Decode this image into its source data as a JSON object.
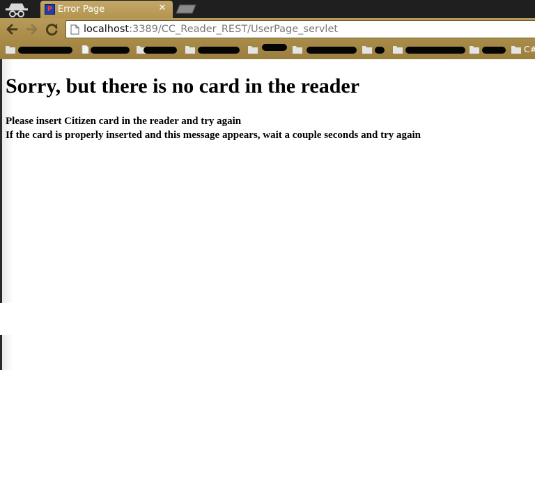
{
  "tab": {
    "title": "Error Page",
    "favicon_glyph": "P",
    "close_icon": "close-icon"
  },
  "address_bar": {
    "host": "localhost",
    "path": ":3389/CC_Reader_REST/UserPage_servlet"
  },
  "bookmarks": [
    {
      "label": "",
      "icon": "folder-icon",
      "redacted": true
    },
    {
      "label": "",
      "icon": "page-icon",
      "redacted": true
    },
    {
      "label": "",
      "icon": "folder-icon",
      "redacted": true
    },
    {
      "label": "",
      "icon": "folder-icon",
      "redacted": true
    },
    {
      "label": "",
      "icon": "folder-icon",
      "redacted": true
    },
    {
      "label": "",
      "icon": "folder-icon",
      "redacted": true
    },
    {
      "label": "",
      "icon": "folder-icon",
      "redacted": true
    },
    {
      "label": "",
      "icon": "folder-icon",
      "redacted": true
    },
    {
      "label": "",
      "icon": "folder-icon",
      "redacted": true
    },
    {
      "label": "C#",
      "icon": "folder-icon",
      "redacted": false
    }
  ],
  "page": {
    "heading": "Sorry, but there is no card in the reader",
    "line1": "Please insert Citizen card in the reader and try again",
    "line2": "If the card is properly inserted and this message appears, wait a couple seconds and try again"
  },
  "colors": {
    "tab": "#c4a86a",
    "toolbar": "#b89b58",
    "bookmarks_bar": "#a88b48",
    "favicon_bg": "#1c3fa8"
  }
}
